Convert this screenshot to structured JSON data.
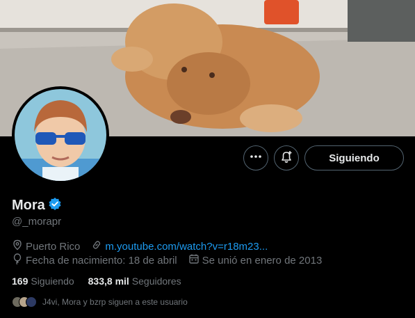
{
  "profile": {
    "display_name": "Mora",
    "handle": "@_morapr",
    "location": "Puerto Rico",
    "website": "m.youtube.com/watch?v=r18m23...",
    "birthday": "Fecha de nacimiento: 18 de abril",
    "joined": "Se unió en enero de 2013"
  },
  "actions": {
    "more_icon": "more-dots-icon",
    "notify_icon": "bell-plus-icon",
    "follow_label": "Siguiendo"
  },
  "stats": {
    "following_count": "169",
    "following_label": "Siguiendo",
    "followers_count": "833,8 mil",
    "followers_label": "Seguidores"
  },
  "known_followers": {
    "text": "J4vi, Mora y bzrp siguen a este usuario"
  },
  "colors": {
    "background": "#000000",
    "text": "#e7e9ea",
    "muted": "#71767b",
    "link": "#1d9bf0",
    "verified": "#1d9bf0"
  }
}
